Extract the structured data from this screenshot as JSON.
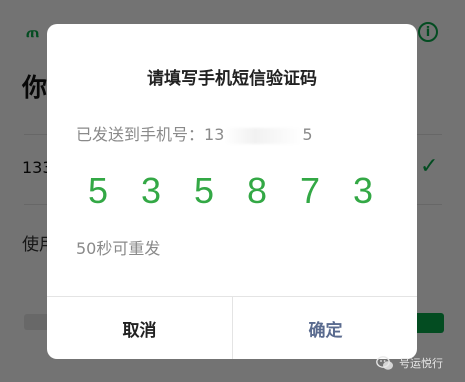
{
  "background_page": {
    "logo_text": "ጠ",
    "title": "你",
    "phone_partial": "133",
    "use_text": "使用"
  },
  "dialog": {
    "title": "请填写手机短信验证码",
    "sent_to_label": "已发送到手机号：",
    "phone_visible_start": "13",
    "phone_visible_end": "5",
    "code_digits": [
      "5",
      "3",
      "5",
      "8",
      "7",
      "3"
    ],
    "resend_countdown": "50秒可重发",
    "cancel_label": "取消",
    "confirm_label": "确定"
  },
  "watermark": {
    "text": "号运悦行"
  },
  "colors": {
    "accent_green": "#07a84a",
    "code_green": "#33a845",
    "confirm_blue": "#5a6b8f",
    "overlay": "rgba(0,0,0,0.55)"
  },
  "icons": [
    "info-icon",
    "checkmark-icon",
    "wechat-logo-icon"
  ]
}
